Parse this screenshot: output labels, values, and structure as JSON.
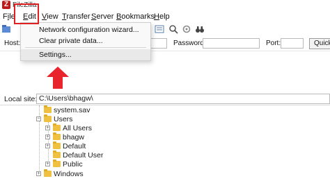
{
  "window": {
    "title": "FileZilla"
  },
  "menu": [
    {
      "label_pre": "F",
      "label_ul": "i",
      "label_post": "le"
    },
    {
      "label_pre": "",
      "label_ul": "E",
      "label_post": "dit"
    },
    {
      "label_pre": "",
      "label_ul": "V",
      "label_post": "iew"
    },
    {
      "label_pre": "",
      "label_ul": "T",
      "label_post": "ransfer"
    },
    {
      "label_pre": "",
      "label_ul": "S",
      "label_post": "erver"
    },
    {
      "label_pre": "",
      "label_ul": "B",
      "label_post": "ookmarks"
    },
    {
      "label_pre": "",
      "label_ul": "H",
      "label_post": "elp"
    }
  ],
  "edit_menu": {
    "items": [
      "Network configuration wizard...",
      "Clear private data...",
      "Settings..."
    ]
  },
  "quickconnect": {
    "host_label": "Host:",
    "password_label": "Password:",
    "port_label": "Port:",
    "button_label": "Quickc"
  },
  "local_site": {
    "label": "Local site:",
    "path": "C:\\Users\\bhagw\\"
  },
  "tree": [
    {
      "label": "system.sav",
      "expander": ""
    },
    {
      "label": "Users",
      "expander": "−"
    },
    {
      "label": "All Users",
      "expander": "+"
    },
    {
      "label": "bhagw",
      "expander": "+"
    },
    {
      "label": "Default",
      "expander": "+"
    },
    {
      "label": "Default User",
      "expander": ""
    },
    {
      "label": "Public",
      "expander": "+"
    },
    {
      "label": "Windows",
      "expander": "+"
    }
  ],
  "colors": {
    "highlight_box": "#e02020",
    "arrow": "#e8242c",
    "folder": "#f0c040",
    "app_icon": "#bf1a1a"
  }
}
